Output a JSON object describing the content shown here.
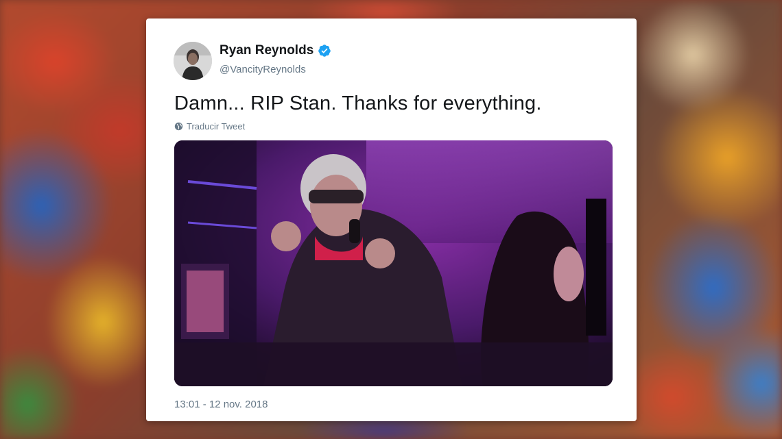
{
  "tweet": {
    "author_name": "Ryan Reynolds",
    "author_handle": "@VancityReynolds",
    "text": "Damn... RIP Stan. Thanks for everything.",
    "translate_label": "Traducir Tweet",
    "timestamp": "13:01 - 12 nov. 2018"
  },
  "icons": {
    "verified": "verified-badge-icon",
    "translate": "globe-icon"
  },
  "colors": {
    "verified_blue": "#1da1f2",
    "secondary_text": "#657786",
    "primary_text": "#14171a"
  }
}
